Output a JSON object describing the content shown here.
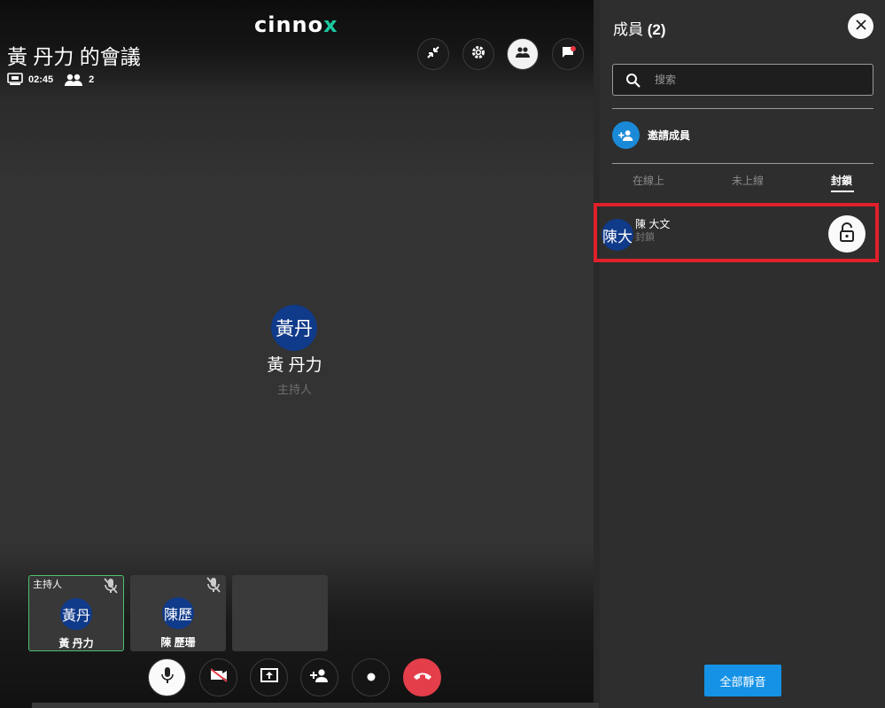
{
  "brand": {
    "logo_main": "cinno",
    "logo_accent": "x",
    "accent_color": "#1dc8a0"
  },
  "meeting": {
    "title": "黃 丹力 的會議",
    "duration": "02:45",
    "participant_count": "2"
  },
  "top_controls": [
    {
      "name": "minimize-icon"
    },
    {
      "name": "gear-icon"
    },
    {
      "name": "people-icon",
      "active": true
    },
    {
      "name": "chat-flag-icon",
      "has_notification": true
    }
  ],
  "main_speaker": {
    "avatar_text": "黃丹",
    "name": "黃 丹力",
    "role": "主持人"
  },
  "tiles": [
    {
      "role": "主持人",
      "avatar_text": "黃丹",
      "name": "黃 丹力",
      "muted": true
    },
    {
      "avatar_text": "陳歷",
      "name": "陳 歷珊",
      "muted": true
    }
  ],
  "bottom_controls": [
    {
      "name": "microphone-icon"
    },
    {
      "name": "camera-off-icon"
    },
    {
      "name": "share-screen-icon"
    },
    {
      "name": "add-person-icon"
    },
    {
      "name": "record-icon"
    },
    {
      "name": "hang-up-icon",
      "color": "#e33e4a"
    }
  ],
  "panel": {
    "title": "成員",
    "count": "(2)",
    "search_placeholder": "搜索",
    "invite_label": "邀請成員",
    "tabs": [
      {
        "label": "在線上",
        "active": false
      },
      {
        "label": "未上線",
        "active": false
      },
      {
        "label": "封鎖",
        "active": true
      }
    ],
    "members": [
      {
        "avatar_text": "陳大",
        "name": "陳 大文",
        "status": "封鎖"
      }
    ],
    "mute_all_label": "全部靜音",
    "button_color": "#1592e6",
    "highlight_color": "#e0202a"
  }
}
